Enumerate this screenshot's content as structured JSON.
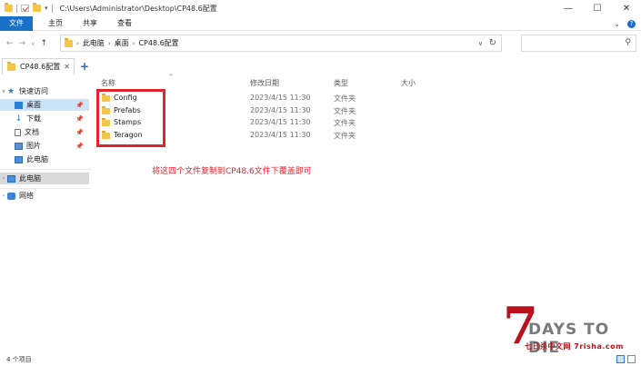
{
  "window": {
    "path_title": "C:\\Users\\Administrator\\Desktop\\CP48.6配置",
    "minimize": "—",
    "maximize": "☐",
    "close": "✕"
  },
  "ribbon": {
    "tabs": [
      "文件",
      "主页",
      "共享",
      "查看"
    ],
    "expand": "⌄",
    "help": "?"
  },
  "address": {
    "crumbs": [
      "此电脑",
      "桌面",
      "CP48.6配置"
    ],
    "search_placeholder": ""
  },
  "tab": {
    "label": "CP48.6配置"
  },
  "navpane": {
    "quick_access": "快速访问",
    "items": [
      {
        "label": "桌面",
        "icon": "desktop-icon"
      },
      {
        "label": "下载",
        "icon": "download-icon"
      },
      {
        "label": "文档",
        "icon": "document-icon"
      },
      {
        "label": "图片",
        "icon": "picture-icon"
      },
      {
        "label": "此电脑",
        "icon": "pc-icon"
      }
    ],
    "this_pc": "此电脑",
    "network": "网络"
  },
  "columns": {
    "name": "名称",
    "modified": "修改日期",
    "type": "类型",
    "size": "大小"
  },
  "files": [
    {
      "name": "Config",
      "modified": "2023/4/15 11:30",
      "type": "文件夹"
    },
    {
      "name": "Prefabs",
      "modified": "2023/4/15 11:30",
      "type": "文件夹"
    },
    {
      "name": "Stamps",
      "modified": "2023/4/15 11:30",
      "type": "文件夹"
    },
    {
      "name": "Teragon",
      "modified": "2023/4/15 11:30",
      "type": "文件夹"
    }
  ],
  "annotation": {
    "text": "将这四个文件复制到CP48.6文件下覆盖即可",
    "color": "#e0242b"
  },
  "watermark": {
    "seven": "7",
    "title": "DAYS TO DIE",
    "subtitle": "七日杀中文网 7risha.com"
  },
  "status": {
    "count": "4 个项目"
  }
}
